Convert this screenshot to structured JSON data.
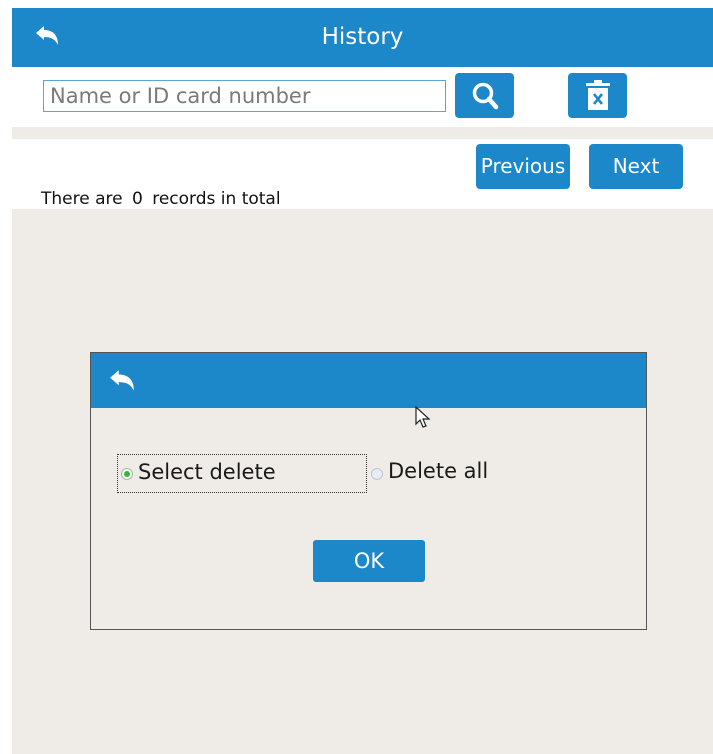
{
  "header": {
    "title": "History",
    "back_icon": "back-arrow-icon"
  },
  "search": {
    "placeholder": "Name or ID card number",
    "value": "",
    "search_icon": "search-icon",
    "delete_icon": "trash-icon"
  },
  "pagination": {
    "previous_label": "Previous",
    "next_label": "Next"
  },
  "records": {
    "prefix": "There are",
    "count": "0",
    "suffix": "records in total"
  },
  "dialog": {
    "back_icon": "back-arrow-icon",
    "options": [
      {
        "label": "Select delete",
        "selected": true
      },
      {
        "label": "Delete all",
        "selected": false
      }
    ],
    "ok_label": "OK"
  },
  "colors": {
    "accent": "#1c87c9",
    "background": "#efebe6",
    "radio_selected": "#3ab33a"
  }
}
